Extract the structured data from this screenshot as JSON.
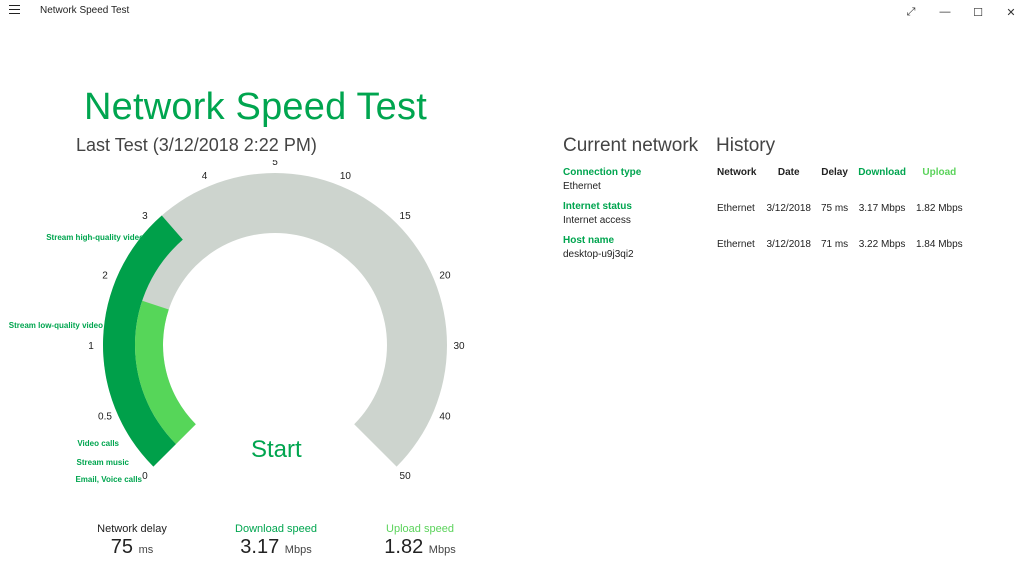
{
  "window": {
    "title": "Network Speed Test",
    "controls": {
      "expand_icon": "expand-arrows-icon",
      "minimize_icon": "minimize-icon",
      "maximize_icon": "maximize-icon",
      "close_icon": "close-icon"
    },
    "glyphs": {
      "menu": "☰",
      "expand": "⤢",
      "minimize": "—",
      "maximize": "☐",
      "close": "✕"
    }
  },
  "header": {
    "title": "Network Speed Test",
    "last_test": "Last Test (3/12/2018 2:22 PM)"
  },
  "gauge": {
    "ticks": [
      "0",
      "0.5",
      "1",
      "2",
      "3",
      "4",
      "5",
      "10",
      "15",
      "20",
      "30",
      "40",
      "50"
    ],
    "tiers": [
      {
        "label": "Email, Voice calls",
        "value": 0
      },
      {
        "label": "Stream music",
        "value": 0.25
      },
      {
        "label": "Video calls",
        "value": 0.5
      },
      {
        "label": "Stream low-quality video",
        "value": 1.5
      },
      {
        "label": "Stream high-quality video",
        "value": 3
      }
    ],
    "download_value": 3.17,
    "upload_value": 1.82,
    "start_label": "Start",
    "colors": {
      "track": "#cdd4ce",
      "download": "#00a04a",
      "upload": "#56d659",
      "accent": "#00a54f"
    }
  },
  "metrics": {
    "delay": {
      "label": "Network delay",
      "value": "75",
      "unit": "ms"
    },
    "download": {
      "label": "Download speed",
      "value": "3.17",
      "unit": "Mbps"
    },
    "upload": {
      "label": "Upload speed",
      "value": "1.82",
      "unit": "Mbps"
    }
  },
  "current_network": {
    "title": "Current network",
    "items": [
      {
        "key": "Connection type",
        "value": "Ethernet"
      },
      {
        "key": "Internet status",
        "value": "Internet access"
      },
      {
        "key": "Host name",
        "value": "desktop-u9j3qi2"
      }
    ]
  },
  "history": {
    "title": "History",
    "columns": [
      "Network",
      "Date",
      "Delay",
      "Download",
      "Upload"
    ],
    "rows": [
      [
        "Ethernet",
        "3/12/2018",
        "75 ms",
        "3.17 Mbps",
        "1.82 Mbps"
      ],
      [
        "Ethernet",
        "3/12/2018",
        "71 ms",
        "3.22 Mbps",
        "1.84 Mbps"
      ]
    ]
  }
}
